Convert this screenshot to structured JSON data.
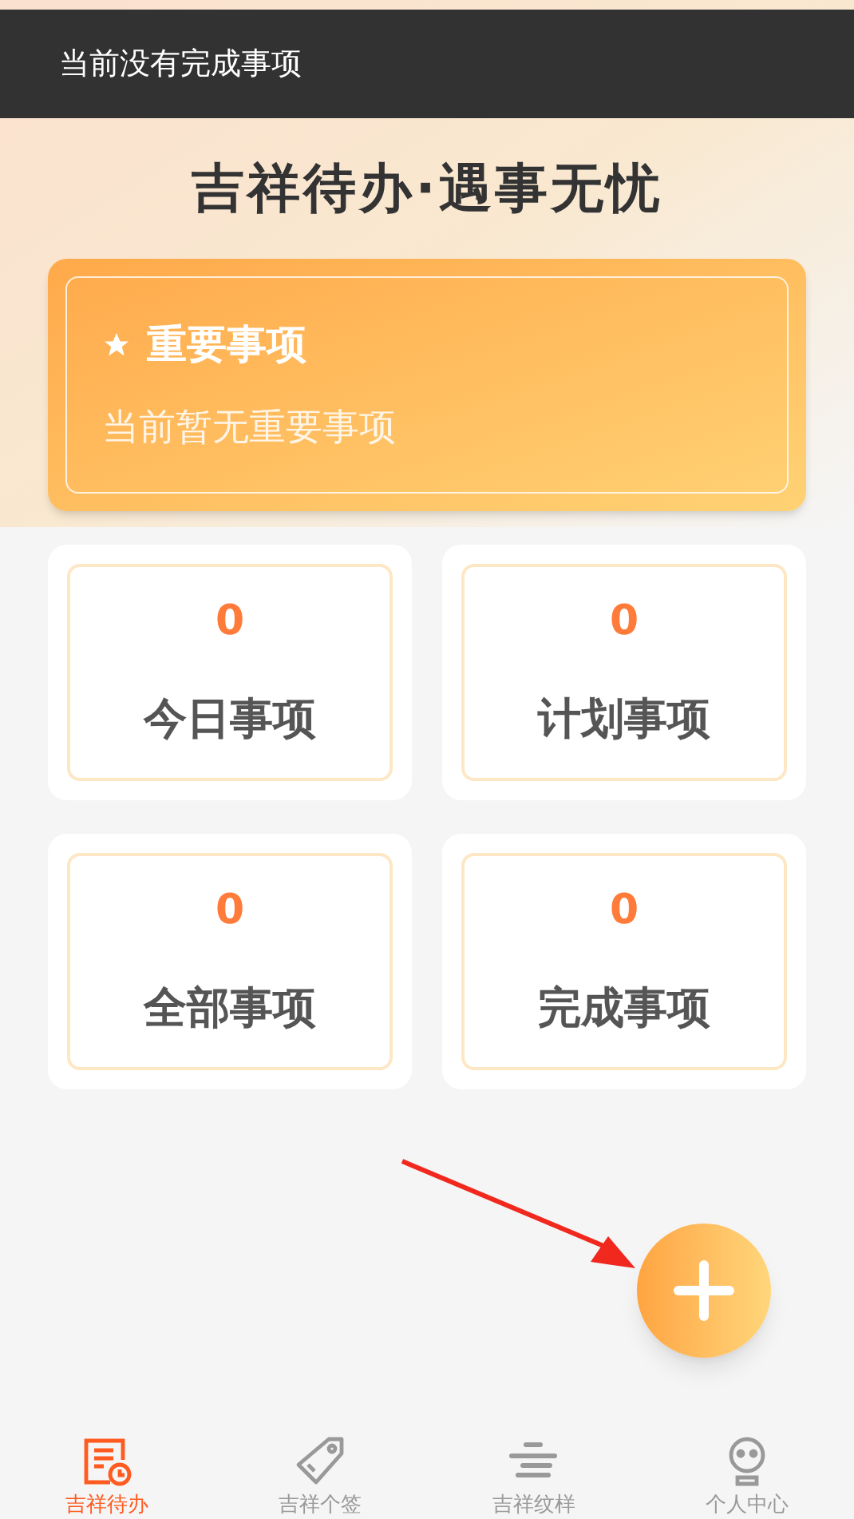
{
  "toast": {
    "text": "当前没有完成事项"
  },
  "title": "吉祥待办·遇事无忧",
  "important": {
    "title": "重要事项",
    "empty_text": "当前暂无重要事项"
  },
  "stats": [
    {
      "count": "0",
      "label": "今日事项"
    },
    {
      "count": "0",
      "label": "计划事项"
    },
    {
      "count": "0",
      "label": "全部事项"
    },
    {
      "count": "0",
      "label": "完成事项"
    }
  ],
  "tabs": [
    {
      "label": "吉祥待办",
      "selected": true,
      "kind": "todo"
    },
    {
      "label": "吉祥个签",
      "selected": false,
      "kind": "tag"
    },
    {
      "label": "吉祥纹样",
      "selected": false,
      "kind": "pattern"
    },
    {
      "label": "个人中心",
      "selected": false,
      "kind": "profile"
    }
  ]
}
